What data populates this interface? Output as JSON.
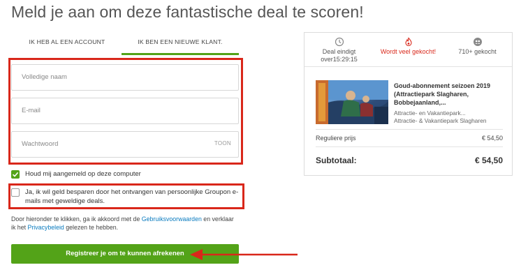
{
  "headline": "Meld je aan om deze fantastische deal te scoren!",
  "tabs": [
    {
      "label": "IK HEB AL EEN ACCOUNT"
    },
    {
      "label": "IK BEN EEN NIEUWE KLANT."
    }
  ],
  "form": {
    "name_placeholder": "Volledige naam",
    "email_placeholder": "E-mail",
    "password_placeholder": "Wachtwoord",
    "show_label": "TOON",
    "remember_label": "Houd mij aangemeld op deze computer",
    "newsletter_label": "Ja, ik wil geld besparen door het ontvangen van persoonlijke Groupon e-mails met geweldige deals.",
    "terms_prefix": "Door hieronder te klikken, ga ik akkoord met de ",
    "terms_link": "Gebruiksvoorwaarden",
    "terms_mid": " en verklaar ik het ",
    "privacy_link": "Privacybeleid",
    "terms_suffix": " gelezen te hebben.",
    "register_label": "Registreer je om te kunnen afrekenen"
  },
  "card": {
    "stats": [
      {
        "label": "Deal eindigt over15:29:15",
        "icon": "clock-icon"
      },
      {
        "label": "Wordt veel gekocht!",
        "icon": "flame-icon"
      },
      {
        "label": "710+ gekocht",
        "icon": "people-icon"
      }
    ],
    "deal_title": "Goud-abonnement seizoen 2019 (Attractiepark Slagharen, Bobbejaanland,...",
    "deal_sub1": "Attractie- en Vakantiepark...",
    "deal_sub2": "Attractie- & Vakantiepark Slagharen",
    "regular_label": "Reguliere prijs",
    "regular_price": "€ 54,50",
    "subtotal_label": "Subtotaal:",
    "subtotal_price": "€ 54,50"
  },
  "colors": {
    "accent_green": "#53a318",
    "annotation_red": "#d9271a",
    "link_blue": "#0a7bbf"
  }
}
